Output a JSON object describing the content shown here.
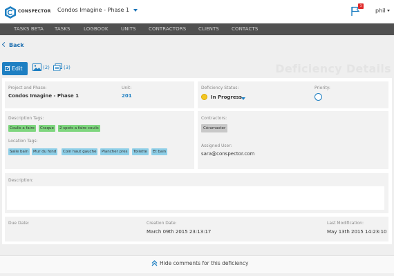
{
  "brand": {
    "name": "CONSPECTOR"
  },
  "project_selector": {
    "value": "Condos Imagine - Phase 1"
  },
  "notifications": {
    "badge": "3"
  },
  "user": {
    "name": "phil"
  },
  "nav": {
    "items": [
      {
        "label": "TASKS BETA"
      },
      {
        "label": "TASKS"
      },
      {
        "label": "LOGBOOK"
      },
      {
        "label": "UNITS"
      },
      {
        "label": "CONTRACTORS"
      },
      {
        "label": "CLIENTS"
      },
      {
        "label": "CONTACTS"
      }
    ]
  },
  "back": {
    "label": "Back"
  },
  "toolbar": {
    "edit_label": "Edit",
    "photos_count": "(2)",
    "comments_count": "(3)"
  },
  "page_title": "Deficiency Details",
  "details": {
    "project_label": "Project and Phase:",
    "project_value": "Condos Imagine - Phase 1",
    "unit_label": "Unit:",
    "unit_value": "201",
    "status_label": "Deficiency Status:",
    "status_value": "In Progress",
    "status_color": "#f3c622",
    "priority_label": "Priority:",
    "description_tags_label": "Description Tags:",
    "description_tags": [
      {
        "label": "Coulis a faire"
      },
      {
        "label": "Craque"
      },
      {
        "label": "2 spots a faire coulis"
      }
    ],
    "location_tags_label": "Location Tags:",
    "location_tags": [
      {
        "label": "Salle bain"
      },
      {
        "label": "Mur du fond"
      },
      {
        "label": "Coin haut gauche"
      },
      {
        "label": "Plancher pres"
      },
      {
        "label": "Toilette"
      },
      {
        "label": "Et bain"
      }
    ],
    "contractors_label": "Contractors:",
    "contractors": [
      {
        "label": "Céramaster"
      }
    ],
    "assigned_user_label": "Assigned User:",
    "assigned_user_value": "sara@conspector.com",
    "description_label": "Description:",
    "description_value": "",
    "due_date_label": "Due Date:",
    "due_date_value": "",
    "creation_date_label": "Creation Date:",
    "creation_date_value": "March 09th 2015 23:13:17",
    "last_modification_label": "Last Modification:",
    "last_modification_value": "May 13th 2015 14:23:10"
  },
  "comments_toggle": {
    "label": "Hide comments for this deficiency"
  },
  "colors": {
    "accent": "#1e7fc2",
    "nav_bg": "#505050",
    "tag_green": "#7ed67e",
    "tag_blue": "#8ecfe8",
    "tag_gray": "#c8c8c8"
  }
}
